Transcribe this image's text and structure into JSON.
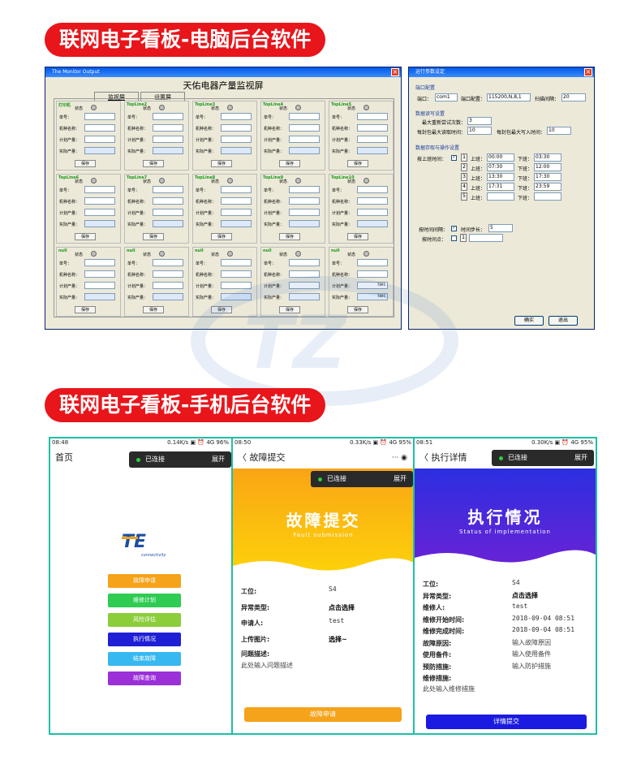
{
  "banner1": "联网电子看板-电脑后台软件",
  "banner2": "联网电子看板-手机后台软件",
  "monitor": {
    "title": "The Monitor Output",
    "heading": "天佑电器产量监视屏",
    "tabs": [
      "监视屏",
      "设置屏"
    ],
    "cells": [
      {
        "name": "打印机"
      },
      {
        "name": "TopLine2"
      },
      {
        "name": "TopLine3"
      },
      {
        "name": "TopLine4"
      },
      {
        "name": "TopLine5"
      },
      {
        "name": "TopLine6"
      },
      {
        "name": "TopLine7"
      },
      {
        "name": "TopLine8"
      },
      {
        "name": "TopLine9"
      },
      {
        "name": "TopLine10"
      },
      {
        "name": "null"
      },
      {
        "name": "null"
      },
      {
        "name": "null"
      },
      {
        "name": "null"
      },
      {
        "name": "null"
      }
    ],
    "state_label": "状态",
    "fields": [
      "单号：",
      "机种名称：",
      "计划产量：",
      "实际产量："
    ],
    "save": "保存",
    "last_plan": "7895",
    "last_actual": "7895"
  },
  "settings": {
    "title": "运行参数设定",
    "sec1": "端口配置",
    "port_label": "端口：",
    "port_value": "com1",
    "cfg_label": "端口配置：",
    "cfg_value": "115200,N,8,1",
    "scan_label": "扫描间隔：",
    "scan_value": "20",
    "sec2": "数据读写设置",
    "retry_label": "最大重新尝试次数：",
    "retry_value": "3",
    "rmax_label": "每封包最大读取时间：",
    "rmax_value": "10",
    "wmax_label": "每封包最大写入时间：",
    "wmax_value": "10",
    "sec3": "数据存取与操作设置",
    "bytime_label": "按上班时间：",
    "on_label": "上班：",
    "off_label": "下班：",
    "shifts": [
      {
        "n": "1",
        "on": "00:00",
        "off": "03:30"
      },
      {
        "n": "2",
        "on": "07:30",
        "off": "12:00"
      },
      {
        "n": "3",
        "on": "13:30",
        "off": "17:30"
      },
      {
        "n": "4",
        "on": "17:31",
        "off": "23:59"
      },
      {
        "n": "5",
        "on": "",
        "off": ""
      }
    ],
    "interval_label": "按时间间隔：",
    "step_label": "时间步长：",
    "step_value": "5",
    "point_label": "按时间点：",
    "point_value": "1",
    "ok": "确实",
    "exit": "退出"
  },
  "phone1": {
    "time": "08:48",
    "speed": "0.14K/s",
    "signal": "4G 96%",
    "title": "首页",
    "connected": "已连接",
    "expand": "展开",
    "logo": "TE",
    "logo_sub": "connectivity",
    "buttons": [
      {
        "label": "故障申请",
        "color": "#f5a31a"
      },
      {
        "label": "维修计划",
        "color": "#2ecc52"
      },
      {
        "label": "风险评估",
        "color": "#8ccd3a"
      },
      {
        "label": "执行情况",
        "color": "#1f1fd6"
      },
      {
        "label": "结束故障",
        "color": "#37b8f0"
      },
      {
        "label": "故障查询",
        "color": "#9b30d9"
      }
    ]
  },
  "phone2": {
    "time": "08:50",
    "speed": "0.33K/s",
    "signal": "4G 95%",
    "back": "〈",
    "title": "故障提交",
    "connected": "已连接",
    "expand": "展开",
    "hero": "故障提交",
    "hero_sub": "Fault submission",
    "station_label": "工位:",
    "station_value": "S4",
    "type_label": "异常类型:",
    "type_value": "点击选择",
    "applicant_label": "申请人:",
    "applicant_value": "test",
    "upload_label": "上传图片:",
    "upload_value": "选择~",
    "desc_label": "问题描述:",
    "desc_placeholder": "此处输入问题描述",
    "submit": "故障申请"
  },
  "phone3": {
    "time": "08:51",
    "speed": "0.30K/s",
    "signal": "4G 95%",
    "back": "〈",
    "title": "执行详情",
    "connected": "已连接",
    "expand": "展开",
    "hero": "执行情况",
    "hero_sub": "Status of implementation",
    "rows": [
      {
        "l": "工位:",
        "v": "S4"
      },
      {
        "l": "异常类型:",
        "v": "点击选择"
      },
      {
        "l": "维修人:",
        "v": "test"
      },
      {
        "l": "维修开始时间:",
        "v": "2018-09-04 08:51"
      },
      {
        "l": "维修完成时间:",
        "v": "2018-09-04 08:51"
      },
      {
        "l": "故障原因:",
        "v": "输入故障原因"
      },
      {
        "l": "使用备件:",
        "v": "输入使用备件"
      },
      {
        "l": "预防措施:",
        "v": "输入防护措施"
      },
      {
        "l": "维修措施:",
        "v": ""
      }
    ],
    "measure_placeholder": "此处输入维修措施",
    "submit": "详情提交"
  }
}
